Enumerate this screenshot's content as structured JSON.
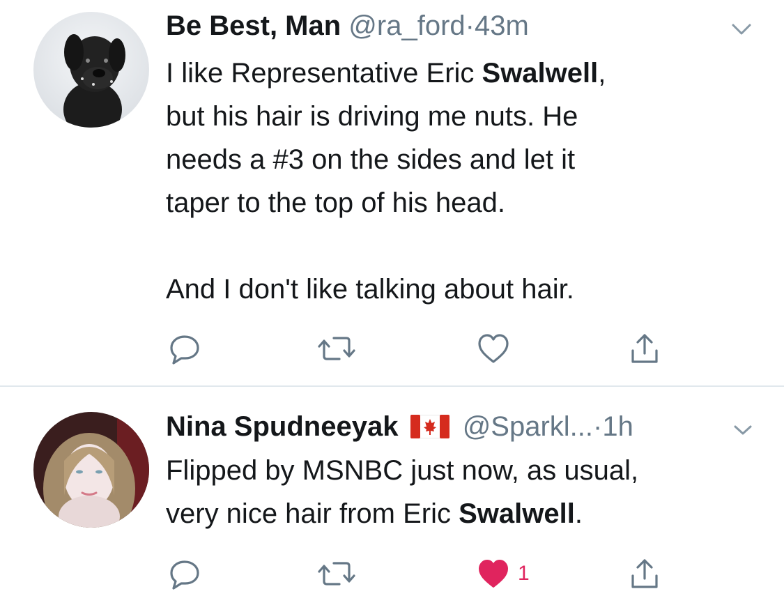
{
  "tweets": [
    {
      "display_name": "Be Best, Man",
      "handle": "@ra_ford",
      "separator": "·",
      "time": "43m",
      "body_lines": [
        [
          {
            "text": "I like Representative Eric ",
            "bold": false
          },
          {
            "text": "Swalwell",
            "bold": true
          },
          {
            "text": ",",
            "bold": false
          }
        ],
        [
          {
            "text": "but his hair is driving me nuts. He",
            "bold": false
          }
        ],
        [
          {
            "text": "needs a #3 on the sides and let it",
            "bold": false
          }
        ],
        [
          {
            "text": "taper to the top of his head.",
            "bold": false
          }
        ],
        [],
        [
          {
            "text": "And I don't like talking about hair.",
            "bold": false
          }
        ]
      ],
      "liked": false,
      "like_count": ""
    },
    {
      "display_name": "Nina Spudneeyak",
      "flag": "canada-flag-icon",
      "handle": "@Sparkl...",
      "separator": "·",
      "time": "1h",
      "body_lines": [
        [
          {
            "text": "Flipped by MSNBC just now, as usual,",
            "bold": false
          }
        ],
        [
          {
            "text": "very nice hair from Eric ",
            "bold": false
          },
          {
            "text": "Swalwell",
            "bold": true
          },
          {
            "text": ".",
            "bold": false
          }
        ]
      ],
      "liked": true,
      "like_count": "1"
    }
  ],
  "colors": {
    "text": "#14171a",
    "secondary": "#657786",
    "like_active": "#e0245e",
    "divider": "#e1e8ed"
  }
}
